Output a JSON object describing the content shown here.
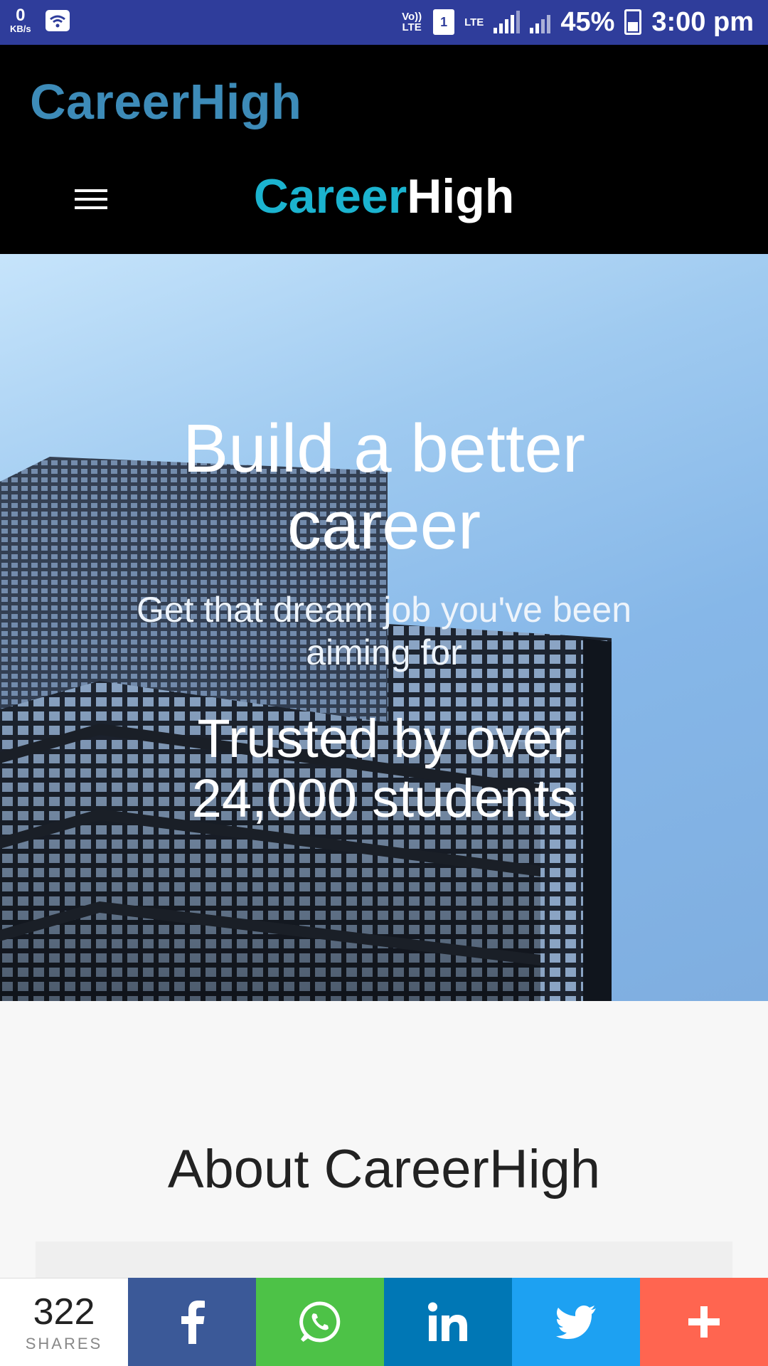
{
  "status_bar": {
    "kbs_value": "0",
    "kbs_unit": "KB/s",
    "volte": "Vo)) LTE",
    "sim": "1",
    "lte": "LTE",
    "battery": "45%",
    "time": "3:00 pm"
  },
  "app": {
    "title": "CareerHigh"
  },
  "nav": {
    "logo_part1": "Career",
    "logo_part2": "High"
  },
  "hero": {
    "title_line1": "Build a better",
    "title_line2": "career",
    "subtitle_line1": "Get that dream job you've been",
    "subtitle_line2": "aiming for",
    "trust_line1": "Trusted by over",
    "trust_line2": "24,000 students"
  },
  "about": {
    "title": "About CareerHigh"
  },
  "share": {
    "count": "322",
    "label": "SHARES",
    "buttons": [
      {
        "icon": "facebook-icon",
        "color": "#3b5998"
      },
      {
        "icon": "whatsapp-icon",
        "color": "#4dc247"
      },
      {
        "icon": "linkedin-icon",
        "color": "#0077b5"
      },
      {
        "icon": "twitter-icon",
        "color": "#1da1f2"
      },
      {
        "icon": "plus-icon",
        "color": "#ff6550"
      }
    ]
  }
}
